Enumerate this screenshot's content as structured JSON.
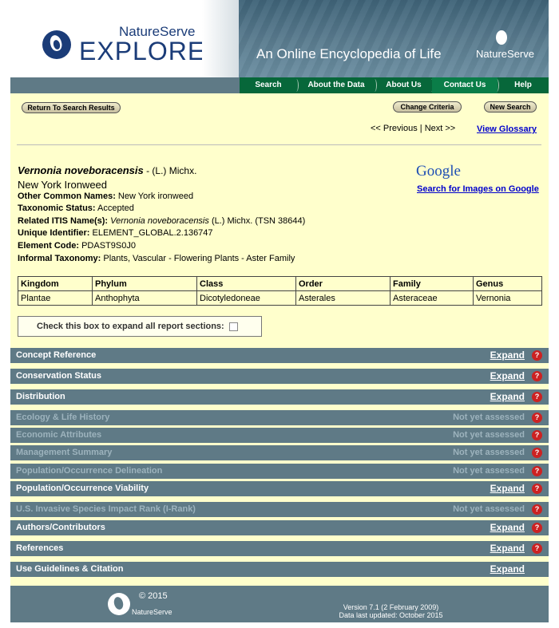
{
  "header": {
    "logo_top": "NatureServe",
    "logo_main": "EXPLORER.",
    "tagline": "An Online Encyclopedia of Life",
    "brand_small": "NatureServe"
  },
  "nav": {
    "items": [
      {
        "label": "Search"
      },
      {
        "label": "About the Data"
      },
      {
        "label": "About Us"
      },
      {
        "label": "Contact Us"
      },
      {
        "label": "Help"
      }
    ]
  },
  "toolbar": {
    "return_label": "Return To Search Results",
    "change_label": "Change Criteria",
    "new_label": "New Search",
    "previous": "<< Previous",
    "separator": "|",
    "next": "Next >>",
    "glossary": "View Glossary"
  },
  "species": {
    "scientific_name": "Vernonia noveboracensis",
    "author": " - (L.) Michx.",
    "common_name": "New York Ironweed",
    "other_common_label": "Other Common Names:",
    "other_common_value": " New York ironweed",
    "status_label": "Taxonomic Status:",
    "status_value": " Accepted",
    "itis_label": "Related ITIS Name(s):",
    "itis_name": " Vernonia noveboracensis",
    "itis_rest": " (L.) Michx. (TSN 38644)",
    "uid_label": "Unique Identifier:",
    "uid_value": " ELEMENT_GLOBAL.2.136747",
    "code_label": "Element Code:",
    "code_value": " PDAST9S0J0",
    "informal_label": "Informal Taxonomy:",
    "informal_value": " Plants, Vascular - Flowering Plants - Aster Family"
  },
  "google": {
    "logo": "Google",
    "link": "Search for Images on Google"
  },
  "taxonomy": {
    "headers": [
      "Kingdom",
      "Phylum",
      "Class",
      "Order",
      "Family",
      "Genus"
    ],
    "values": [
      "Plantae",
      "Anthophyta",
      "Dicotyledoneae",
      "Asterales",
      "Asteraceae",
      "Vernonia"
    ]
  },
  "expand_all": {
    "label": "Check this box to expand all report sections:"
  },
  "sections": [
    {
      "title": "Concept Reference",
      "action": "Expand",
      "dim": false,
      "help": true
    },
    {
      "title": "Conservation Status",
      "action": "Expand",
      "dim": false,
      "help": true
    },
    {
      "title": "Distribution",
      "action": "Expand",
      "dim": false,
      "help": true
    },
    {
      "title": "Ecology & Life History",
      "action": "Not yet assessed",
      "dim": true,
      "help": true
    },
    {
      "title": "Economic Attributes",
      "action": "Not yet assessed",
      "dim": true,
      "help": true
    },
    {
      "title": "Management Summary",
      "action": "Not yet assessed",
      "dim": true,
      "help": true
    },
    {
      "title": "Population/Occurrence Delineation",
      "action": "Not yet assessed",
      "dim": true,
      "help": true
    },
    {
      "title": "Population/Occurrence Viability",
      "action": "Expand",
      "dim": false,
      "help": true
    },
    {
      "title": "U.S. Invasive Species Impact Rank (I-Rank)",
      "action": "Not yet assessed",
      "dim": true,
      "help": true
    },
    {
      "title": "Authors/Contributors",
      "action": "Expand",
      "dim": false,
      "help": true
    },
    {
      "title": "References",
      "action": "Expand",
      "dim": false,
      "help": true
    },
    {
      "title": "Use Guidelines & Citation",
      "action": "Expand",
      "dim": false,
      "help": false
    }
  ],
  "help_glyph": "?",
  "footer": {
    "copyright": "© 2015",
    "brand": "NatureServe",
    "version": "Version 7.1 (2 February 2009)",
    "updated": "Data last updated: October 2015"
  },
  "colors": {
    "nav_green": "#07673a",
    "section_bar": "#5f7a86",
    "body_yellow": "#ffffcc",
    "help_red": "#cc2222",
    "link_blue": "#0000cc"
  }
}
